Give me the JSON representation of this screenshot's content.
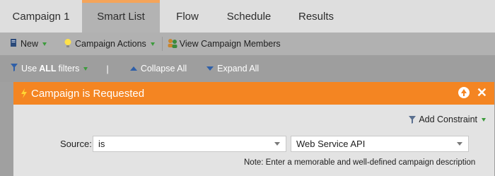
{
  "tabs": [
    {
      "label": "Campaign 1"
    },
    {
      "label": "Smart List"
    },
    {
      "label": "Flow"
    },
    {
      "label": "Schedule"
    },
    {
      "label": "Results"
    }
  ],
  "active_tab": "Smart List",
  "toolbar": {
    "new_label": "New",
    "campaign_actions_label": "Campaign Actions",
    "view_members_label": "View Campaign Members"
  },
  "filterbar": {
    "use_label": "Use",
    "all_label": "ALL",
    "filters_label": "filters",
    "pipe": "|",
    "collapse_label": "Collapse All",
    "expand_label": "Expand All"
  },
  "trigger": {
    "title": "Campaign is Requested",
    "add_constraint_label": "Add Constraint",
    "source_label": "Source:",
    "operator_value": "is",
    "source_value": "Web Service API",
    "note": "Note: Enter a memorable and well-defined campaign description"
  },
  "colors": {
    "accent_orange": "#f48522",
    "tab_active_bg": "#b3b3b3",
    "toolbar_bg": "#b1b1b1",
    "filterbar_bg": "#9e9e9e"
  },
  "icons": {
    "new": "document-icon",
    "campaign_actions": "lightbulb-icon",
    "view_members": "people-icon",
    "use_filters": "funnel-icon",
    "collapse": "triangle-up-icon",
    "expand": "triangle-down-icon",
    "trigger": "lightning-icon",
    "move_up": "circle-up-icon",
    "close": "close-icon",
    "add_constraint": "funnel-icon"
  }
}
